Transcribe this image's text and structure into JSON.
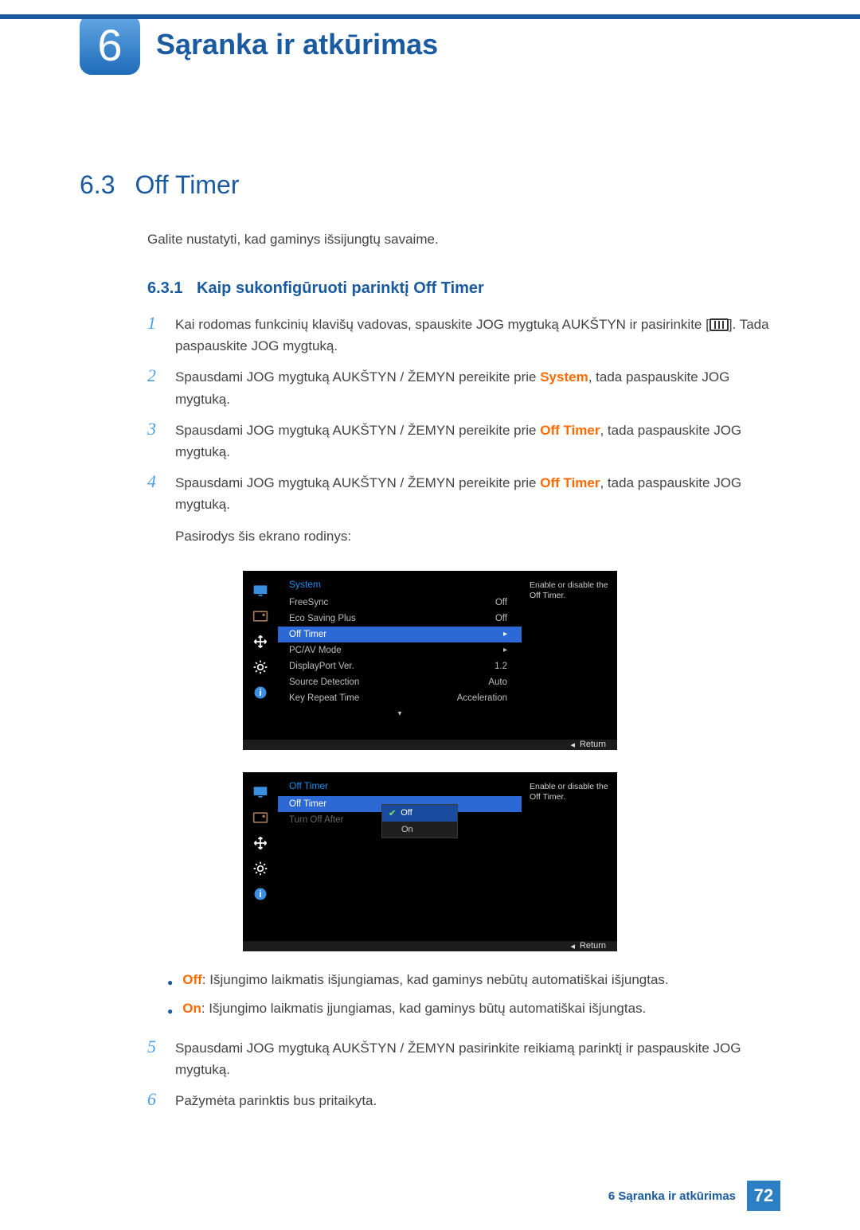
{
  "chapter": {
    "number": "6",
    "title": "Sąranka ir atkūrimas"
  },
  "section": {
    "number": "6.3",
    "title": "Off Timer"
  },
  "intro": "Galite nustatyti, kad gaminys išsijungtų savaime.",
  "subsection": {
    "number": "6.3.1",
    "title": "Kaip sukonfigūruoti parinktį Off Timer"
  },
  "steps": {
    "s1a": "Kai rodomas funkcinių klavišų vadovas, spauskite JOG mygtuką AUKŠTYN ir pasirinkite [",
    "s1b": "]. Tada paspauskite JOG mygtuką.",
    "s2a": "Spausdami JOG mygtuką AUKŠTYN / ŽEMYN pereikite prie ",
    "s2_hl": "System",
    "s2b": ", tada paspauskite JOG mygtuką.",
    "s3a": "Spausdami JOG mygtuką AUKŠTYN / ŽEMYN pereikite prie ",
    "s3_hl": "Off Timer",
    "s3b": ", tada paspauskite JOG mygtuką.",
    "s4a": "Spausdami JOG mygtuką AUKŠTYN / ŽEMYN pereikite prie ",
    "s4_hl": "Off Timer",
    "s4b": ", tada paspauskite JOG mygtuką.",
    "s4c": "Pasirodys šis ekrano rodinys:",
    "s5": "Spausdami JOG mygtuką AUKŠTYN / ŽEMYN pasirinkite reikiamą parinktį ir paspauskite JOG mygtuką.",
    "s6": "Pažymėta parinktis bus pritaikyta."
  },
  "osd1": {
    "title": "System",
    "desc": "Enable or disable the Off Timer.",
    "items": [
      {
        "label": "FreeSync",
        "value": "Off"
      },
      {
        "label": "Eco Saving Plus",
        "value": "Off"
      },
      {
        "label": "Off Timer",
        "value": "▸"
      },
      {
        "label": "PC/AV Mode",
        "value": "▸"
      },
      {
        "label": "DisplayPort Ver.",
        "value": "1.2"
      },
      {
        "label": "Source Detection",
        "value": "Auto"
      },
      {
        "label": "Key Repeat Time",
        "value": "Acceleration"
      }
    ],
    "return": "Return"
  },
  "osd2": {
    "title": "Off Timer",
    "desc": "Enable or disable the Off Timer.",
    "items": [
      {
        "label": "Off Timer",
        "value": "Off"
      },
      {
        "label": "Turn Off After",
        "value": "On"
      }
    ],
    "dropdown": {
      "off": "Off",
      "on": "On"
    },
    "return": "Return"
  },
  "bullets": {
    "off_label": "Off",
    "off_text": ": Išjungimo laikmatis išjungiamas, kad gaminys nebūtų automatiškai išjungtas.",
    "on_label": "On",
    "on_text": ": Išjungimo laikmatis įjungiamas, kad gaminys būtų automatiškai išjungtas."
  },
  "footer": {
    "text": "6 Sąranka ir atkūrimas",
    "page": "72"
  }
}
